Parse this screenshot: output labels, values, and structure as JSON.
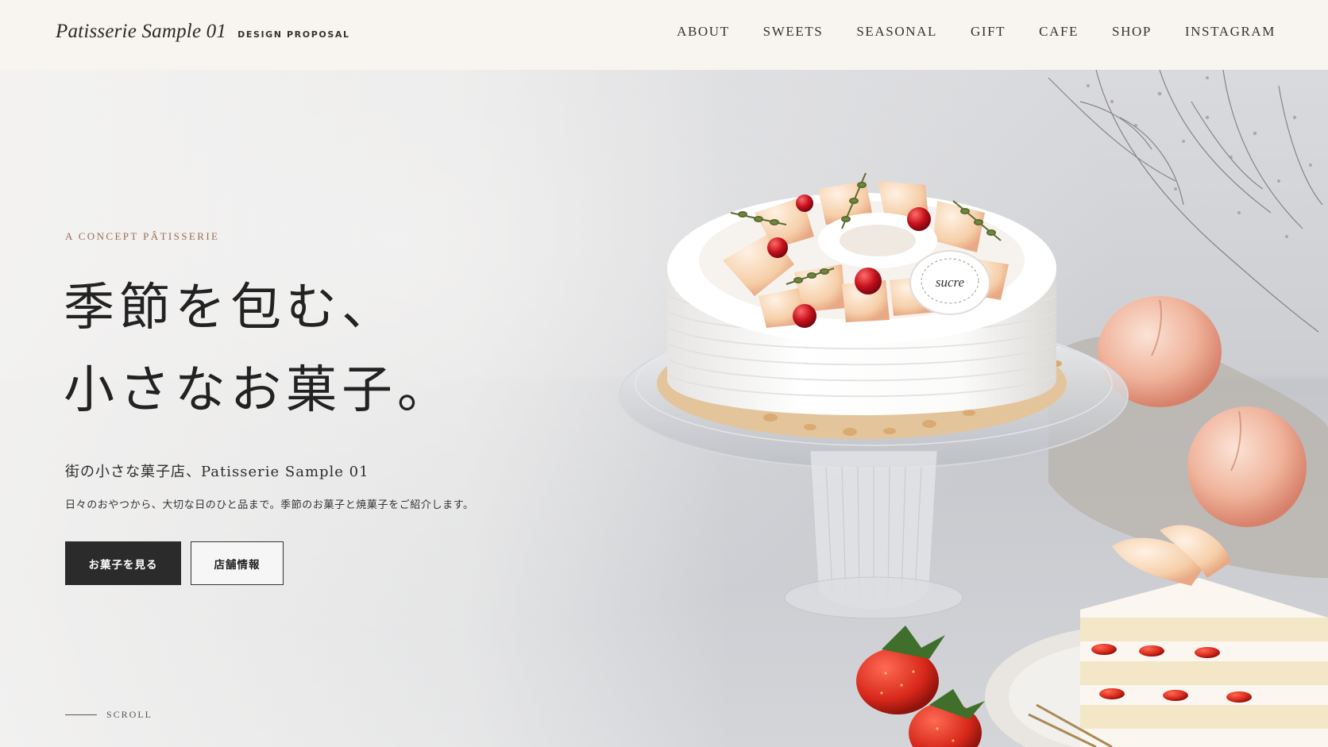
{
  "header": {
    "brand_name": "Patisserie Sample 01",
    "brand_tag": "DESIGN PROPOSAL",
    "nav": [
      "ABOUT",
      "SWEETS",
      "SEASONAL",
      "GIFT",
      "CAFE",
      "SHOP",
      "INSTAGRAM"
    ]
  },
  "hero": {
    "eyebrow": "A CONCEPT PÂTISSERIE",
    "headline_line1": "季節を包む、",
    "headline_line2": "小さなお菓子。",
    "subheading": "街の小さな菓子店、Patisserie Sample 01",
    "description": "日々のおやつから、大切な日のひと品まで。季節のお菓子と焼菓子をご紹介します。",
    "primary_button": "お菓子を見る",
    "secondary_button": "店舗情報",
    "scroll_label": "SCROLL",
    "cake_plaque": "sucre"
  },
  "colors": {
    "accent_eyebrow": "#9a6d57",
    "button_dark": "#2b2b2b",
    "header_bg": "#f8f5f0"
  }
}
